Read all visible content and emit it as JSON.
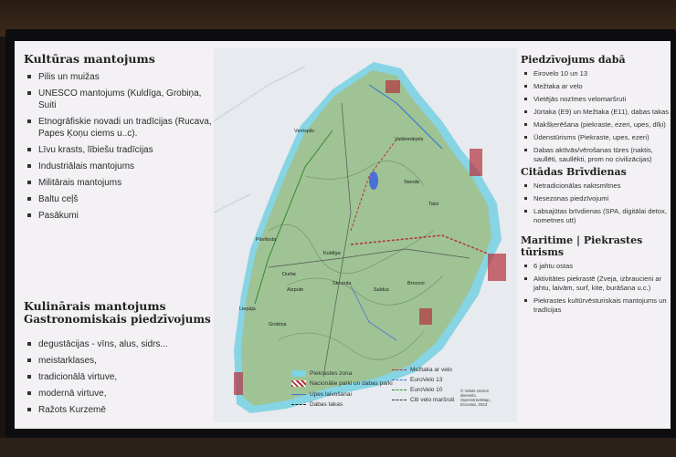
{
  "left": {
    "culture": {
      "title": "Kultūras mantojums",
      "items": [
        "Pilis un muižas",
        "UNESCO mantojums (Kuldīga, Grobiņa, Suiti",
        "Etnogrāfiskie novadi un tradīcijas (Rucava, Papes Ķoņu ciems u..c).",
        "Līvu krasts, lībiešu tradīcijas",
        "Industriālais mantojums",
        "Militārais mantojums",
        "Baltu ceļš",
        "Pasākumi"
      ]
    },
    "culinary": {
      "title": "Kulinārais mantojums",
      "subtitle": "Gastronomiskais piedzīvojums",
      "items": [
        "degustācijas - vīns, alus, sidrs...",
        "meistarklases,",
        "tradicionālā virtuve,",
        "modernā virtuve,",
        "Ražots Kurzemē"
      ]
    }
  },
  "right": {
    "nature": {
      "title": "Piedzīvojums dabā",
      "items": [
        "Eirovelo 10 un 13",
        "Mežtaka ar velo",
        "Vietējās nozīmes velomaršruti",
        "Jūrtaka (E9) un Mežtaka (E11), dabas takas",
        "Makšķerēšana (piekraste, ezeri, upes, dīķi)",
        "Ūdenstūrisms (Piekraste, upes, ezeri)",
        "Dabas aktīvās/vērošanas tūres (naktis, saullēti, saullēkti, prom no civilizācijas)"
      ]
    },
    "holidays": {
      "title": "Citādas Brīvdienas",
      "items": [
        "Netradicionālas naktsmītnes",
        "Nesezonas piedzīvojumi",
        "Labsajūtas brīvdienas (SPA, digitālai detox, nometnes utt)"
      ]
    },
    "maritime": {
      "title": "Maritime | Piekrastes tūrisms",
      "items": [
        "6 jahtu ostas",
        "Aktivitātes piekrastē (Zveja, izbraucieni ar jahtu, laivām, surf, kite, burāšana u.c.)",
        "Piekrastes kultūrvēsturiskais mantojums un tradīcijas"
      ]
    }
  },
  "map": {
    "towns": [
      "Ventspils",
      "Valdemārpils",
      "Talsi",
      "Stende",
      "Kuldīga",
      "Pāvilosta",
      "Skrunda",
      "Saldus",
      "Liepāja",
      "Durbe",
      "Aizpute",
      "Grobiņa",
      "Broceni"
    ],
    "legend": [
      {
        "label": "Piekrastes zona",
        "color": "#7fd3e3"
      },
      {
        "label": "Nacionālie parki un dabas parki",
        "color": "#b5303c"
      },
      {
        "label": "Upes laivošanai",
        "color": "#4a6fd6"
      },
      {
        "label": "Dabas takas",
        "color": "#222222"
      },
      {
        "label": "Mežtaka ar velo",
        "color": "#b5303c"
      },
      {
        "label": "EuroVelo 13",
        "color": "#2c6fd6"
      },
      {
        "label": "EuroVelo 10",
        "color": "#2f8a2f"
      },
      {
        "label": "Citi velo maršruti",
        "color": "#333333"
      }
    ],
    "credit": "© Valsts zemes dienests, OpenStreetMap, Eurostat, 2023"
  }
}
